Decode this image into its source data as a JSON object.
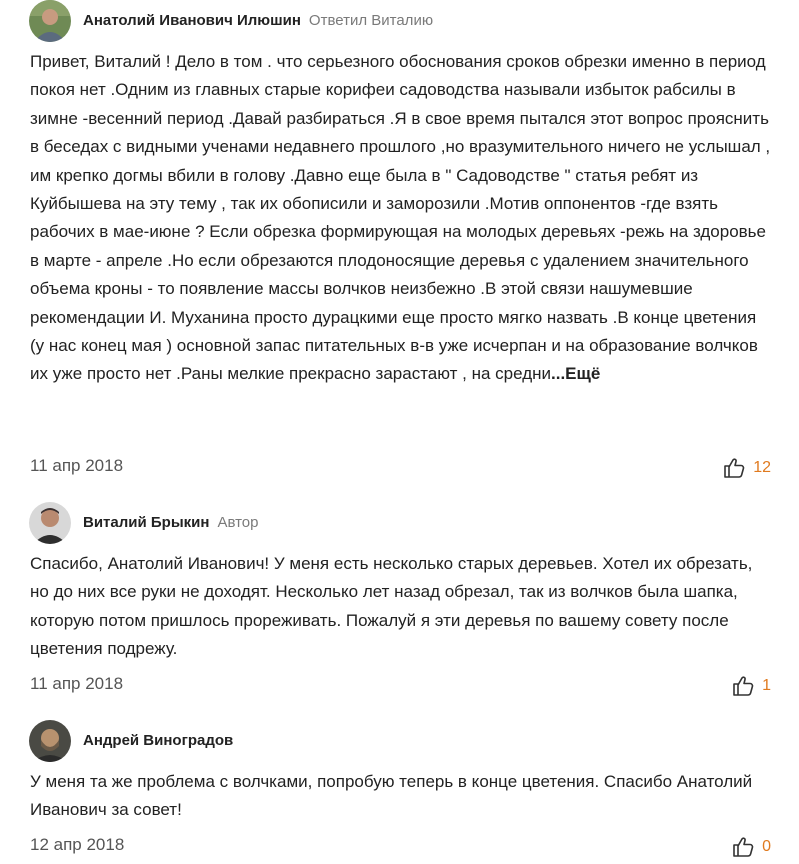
{
  "comments": [
    {
      "author": "Анатолий Иванович Илюшин",
      "meta": "Ответил Виталию",
      "text": "Привет, Виталий ! Дело в том . что серьезного обоснования сроков обрезки именно в период покоя нет .Одним из главных старые корифеи садоводства называли избыток рабсилы в зимне -весенний период .Давай разбираться .Я в свое время пытался этот вопрос прояснить в беседах с видными ученами недавнего прошлого ,но вразумительного ничего не услышал , им крепко догмы вбили в голову .Давно еще была в \" Садоводстве \" статья ребят из Куйбышева на эту тему , так их обописили и заморозили .Мотив оппонентов -где взять рабочих в мае-июне ? Если обрезка формирующая на молодых деревьях -режь на здоровье в марте - апреле .Но если обрезаются плодоносящие деревья с удалением значительного объема кроны - то появление массы волчков неизбежно .В этой связи нашумевшие рекомендации И. Муханина просто дурацкими еще просто мягко назвать .В конце цветения (у нас конец мая ) основной запас питательных в-в уже исчерпан и на образование волчков их уже просто нет .Раны мелкие прекрасно зарастают , на средни",
      "more_label": "...Ещё",
      "date": "11 апр 2018",
      "likes": "12",
      "like_color": "#e07a1f"
    },
    {
      "author": "Виталий Брыкин",
      "meta": "Автор",
      "text": "Спасибо, Анатолий Иванович! У меня есть несколько старых деревьев. Хотел их обрезать, но до них все руки не доходят. Несколько лет назад обрезал, так из волчков была шапка, которую потом пришлось прореживать. Пожалуй я эти деревья по вашему совету после цветения подрежу.",
      "date": "11 апр 2018",
      "likes": "1",
      "like_color": "#e07a1f"
    },
    {
      "author": "Андрей Виноградов",
      "text": "У меня та же проблема с волчками, попробую теперь в конце цветения. Спасибо Анатолий Иванович за совет!",
      "date": "12 апр 2018",
      "likes": "0",
      "like_color": "#e07a1f"
    }
  ],
  "icons": {
    "like": "thumbs-up-icon",
    "avatar": "user-photo"
  }
}
